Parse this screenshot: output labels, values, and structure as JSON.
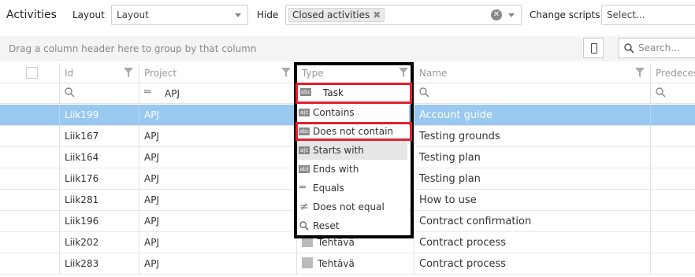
{
  "toolbar": {
    "title": "Activities",
    "layout_label": "Layout",
    "layout_value": "Layout",
    "hide_label": "Hide",
    "hide_chip": "Closed activities",
    "change_scripts_label": "Change scripts",
    "change_scripts_placeholder": "Select..."
  },
  "groupbar": {
    "text": "Drag a column header here to group by that column",
    "search_placeholder": "Search..."
  },
  "columns": [
    "Id",
    "Project",
    "Type",
    "Name",
    "Predecess"
  ],
  "filters": {
    "project_value": "APJ",
    "type_value": "Task"
  },
  "rows": [
    {
      "id": "Liik199",
      "project": "APJ",
      "type": "",
      "name": "Account guide",
      "selected": true
    },
    {
      "id": "Liik167",
      "project": "APJ",
      "type": "",
      "name": "Testing grounds"
    },
    {
      "id": "Liik164",
      "project": "APJ",
      "type": "",
      "name": "Testing plan"
    },
    {
      "id": "Liik176",
      "project": "APJ",
      "type": "",
      "name": "Testing plan"
    },
    {
      "id": "Liik281",
      "project": "APJ",
      "type": "",
      "name": "How to use"
    },
    {
      "id": "Liik196",
      "project": "APJ",
      "type": "",
      "name": "Contract confirmation"
    },
    {
      "id": "Liik202",
      "project": "APJ",
      "type": "Tehtävä",
      "name": "Contract process"
    },
    {
      "id": "Liik283",
      "project": "APJ",
      "type": "Tehtävä",
      "name": "Contract process"
    }
  ],
  "filter_menu": {
    "contains": "Contains",
    "does_not_contain": "Does not contain",
    "starts_with": "Starts with",
    "ends_with": "Ends with",
    "equals": "Equals",
    "does_not_equal": "Does not equal",
    "reset": "Reset"
  },
  "colors": {
    "selected_row": "#99c9f0",
    "highlight_red": "#e0202e"
  }
}
